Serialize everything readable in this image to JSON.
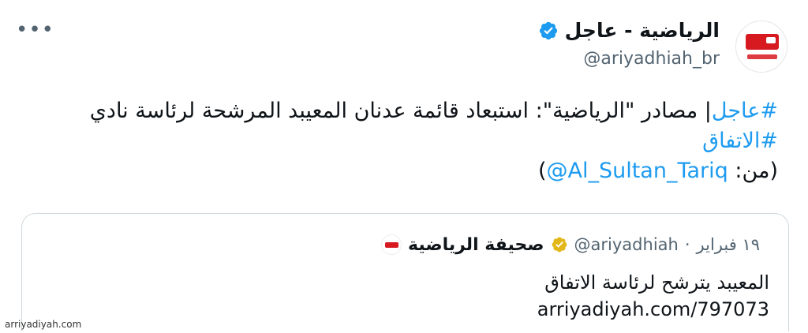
{
  "tweet": {
    "display_name": "الرياضية - عاجل",
    "handle": "@ariyadhiah_br",
    "more_label": "•••",
    "line1_hashtag": "#عاجل",
    "line1_text": "| مصادر \"الرياضية\": استبعاد قائمة عدنان المعيبد المرشحة لرئاسة نادي",
    "line2_hashtag": "#الاتفاق",
    "line3_prefix": "(من: ",
    "line3_mention": "@Al_Sultan_Tariq",
    "line3_suffix": ")"
  },
  "quote": {
    "name": "صحيفة الرياضية",
    "handle": "@ariyadhiah",
    "dot": "·",
    "date": "١٩ فبراير",
    "body_line1": "المعيبد يترشح لرئاسة الاتفاق",
    "url": "arriyadiyah.com/797073"
  },
  "watermark": "arriyadiyah.com",
  "colors": {
    "link": "#1d9bf0",
    "verified_blue": "#1d9bf0",
    "verified_gold": "#e2b719",
    "brand_red": "#d71920"
  },
  "icons": {
    "avatar": "ariyadhiah-br-logo",
    "verified": "verified-badge-icon",
    "quote_verified": "gold-verified-badge-icon"
  }
}
